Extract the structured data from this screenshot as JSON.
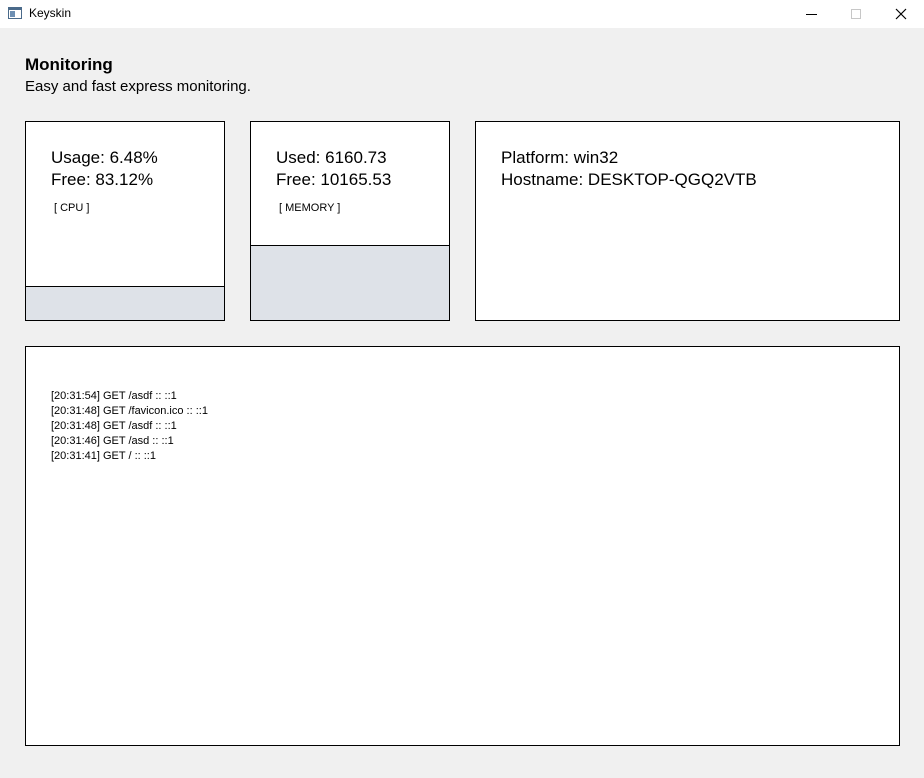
{
  "window": {
    "title": "Keyskin",
    "controls": {
      "minimize_icon": "minimize-icon",
      "maximize_icon": "maximize-icon",
      "close_icon": "close-icon"
    }
  },
  "header": {
    "title": "Monitoring",
    "subtitle": "Easy and fast express monitoring."
  },
  "cpu": {
    "usage": "Usage: 6.48%",
    "free": "Free: 83.12%",
    "label": "[ CPU ]",
    "usage_fraction": 0.17
  },
  "memory": {
    "used": "Used: 6160.73",
    "free": "Free: 10165.53",
    "label": "[ MEMORY ]",
    "usage_fraction": 0.38
  },
  "system": {
    "platform": "Platform: win32",
    "hostname": "Hostname: DESKTOP-QGQ2VTB"
  },
  "log": {
    "entries": [
      "[20:31:54] GET /asdf :: ::1",
      "[20:31:48] GET /favicon.ico :: ::1",
      "[20:31:48] GET /asdf :: ::1",
      "[20:31:46] GET /asd :: ::1",
      "[20:31:41] GET / :: ::1"
    ]
  },
  "colors": {
    "background": "#f0f0f0",
    "card": "#ffffff",
    "usage_fill": "#dee2e8"
  }
}
